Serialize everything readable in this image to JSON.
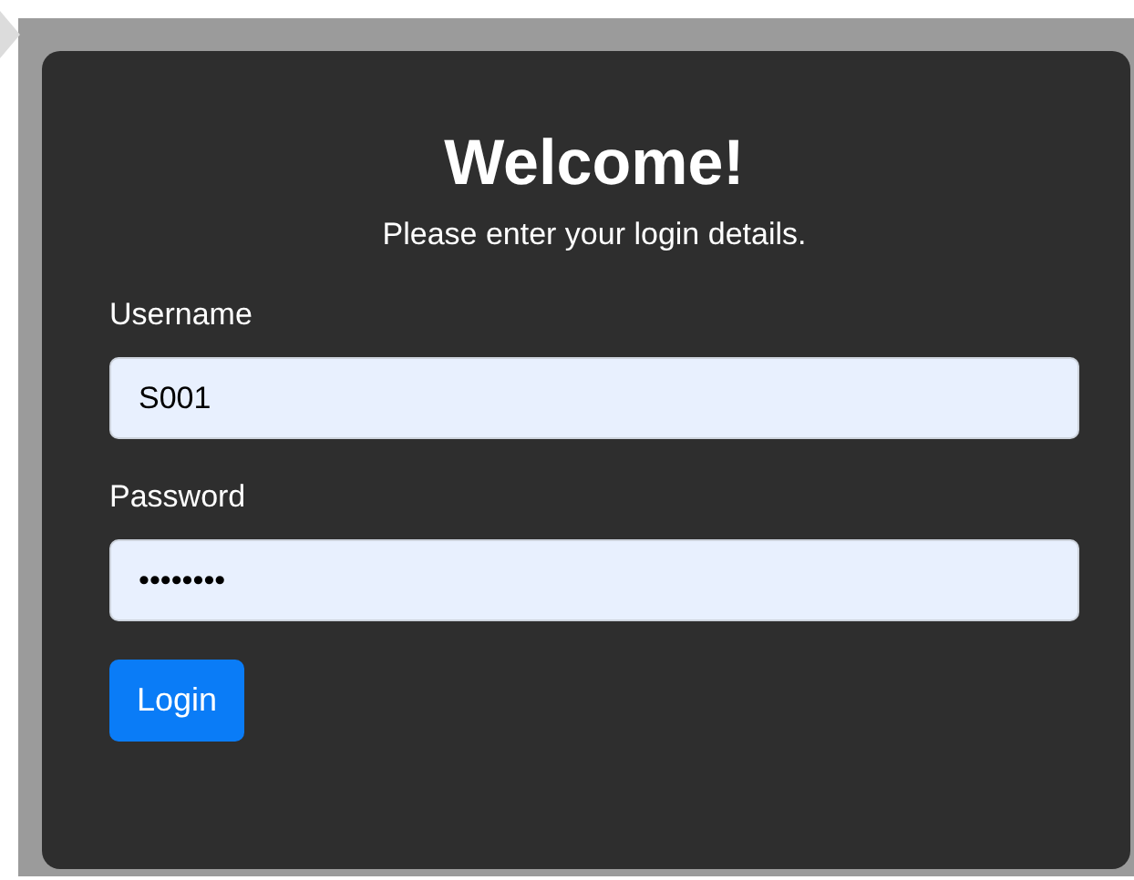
{
  "title": "Welcome!",
  "subtitle": "Please enter your login details.",
  "fields": [
    {
      "label": "Username",
      "value": "S001"
    },
    {
      "label": "Password",
      "value": "••••••••"
    }
  ],
  "button": "Login"
}
